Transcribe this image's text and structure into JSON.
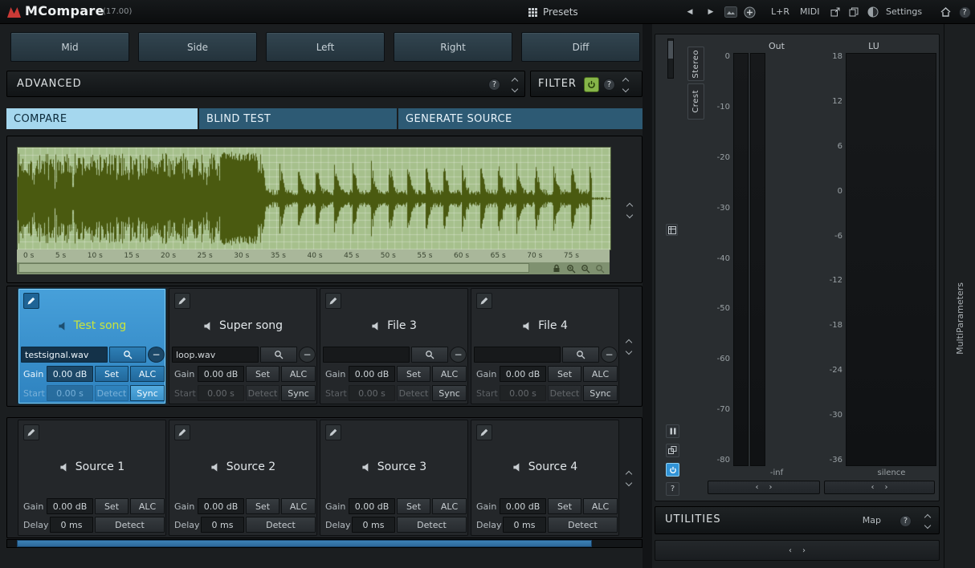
{
  "colors": {
    "accent_blue": "#3498d8",
    "active_tab": "#a5d7ee",
    "selected_slot": "#3795d3",
    "highlight_name": "#c9e43c",
    "filter_power_green": "#86b549",
    "wave_bg": "#a6c08c",
    "wave_grid": "rgba(255,255,255,0.28)",
    "wave_fg": "#4a5a10"
  },
  "titlebar": {
    "app_title": "MCompare",
    "version": "(17.00)",
    "presets_label": "Presets",
    "lr_label": "L+R",
    "midi_label": "MIDI",
    "settings_label": "Settings"
  },
  "channel_buttons": [
    "Mid",
    "Side",
    "Left",
    "Right",
    "Diff"
  ],
  "advanced_bar": {
    "label": "ADVANCED"
  },
  "filter_bar": {
    "label": "FILTER"
  },
  "tabs": {
    "compare": "COMPARE",
    "blind_test": "BLIND TEST",
    "generate_source": "GENERATE SOURCE"
  },
  "waveform": {
    "time_labels": [
      "0 s",
      "5 s",
      "10 s",
      "15 s",
      "20 s",
      "25 s",
      "30 s",
      "35 s",
      "40 s",
      "45 s",
      "50 s",
      "55 s",
      "60 s",
      "65 s",
      "70 s",
      "75 s"
    ]
  },
  "file_slots": [
    {
      "name": "Test song",
      "filename": "testsignal.wav",
      "gain_label": "Gain",
      "gain_value": "0.00 dB",
      "set_label": "Set",
      "alc_label": "ALC",
      "start_label": "Start",
      "start_value": "0.00 s",
      "detect_label": "Detect",
      "sync_label": "Sync"
    },
    {
      "name": "Super song",
      "filename": "loop.wav",
      "gain_label": "Gain",
      "gain_value": "0.00 dB",
      "set_label": "Set",
      "alc_label": "ALC",
      "start_label": "Start",
      "start_value": "0.00 s",
      "detect_label": "Detect",
      "sync_label": "Sync"
    },
    {
      "name": "File 3",
      "filename": "",
      "gain_label": "Gain",
      "gain_value": "0.00 dB",
      "set_label": "Set",
      "alc_label": "ALC",
      "start_label": "Start",
      "start_value": "0.00 s",
      "detect_label": "Detect",
      "sync_label": "Sync"
    },
    {
      "name": "File 4",
      "filename": "",
      "gain_label": "Gain",
      "gain_value": "0.00 dB",
      "set_label": "Set",
      "alc_label": "ALC",
      "start_label": "Start",
      "start_value": "0.00 s",
      "detect_label": "Detect",
      "sync_label": "Sync"
    }
  ],
  "source_slots": [
    {
      "name": "Source 1",
      "gain_label": "Gain",
      "gain_value": "0.00 dB",
      "set_label": "Set",
      "alc_label": "ALC",
      "delay_label": "Delay",
      "delay_value": "0 ms",
      "detect_label": "Detect"
    },
    {
      "name": "Source 2",
      "gain_label": "Gain",
      "gain_value": "0.00 dB",
      "set_label": "Set",
      "alc_label": "ALC",
      "delay_label": "Delay",
      "delay_value": "0 ms",
      "detect_label": "Detect"
    },
    {
      "name": "Source 3",
      "gain_label": "Gain",
      "gain_value": "0.00 dB",
      "set_label": "Set",
      "alc_label": "ALC",
      "delay_label": "Delay",
      "delay_value": "0 ms",
      "detect_label": "Detect"
    },
    {
      "name": "Source 4",
      "gain_label": "Gain",
      "gain_value": "0.00 dB",
      "set_label": "Set",
      "alc_label": "ALC",
      "delay_label": "Delay",
      "delay_value": "0 ms",
      "detect_label": "Detect"
    }
  ],
  "meter_panel": {
    "out_label": "Out",
    "lu_label": "LU",
    "stereo_tab": "Stereo",
    "crest_tab": "Crest",
    "out_scale": [
      "0",
      "-10",
      "-20",
      "-30",
      "-40",
      "-50",
      "-60",
      "-70",
      "-80"
    ],
    "out_value": "-inf",
    "lu_scale": [
      "18",
      "12",
      "6",
      "0",
      "-6",
      "-12",
      "-18",
      "-24",
      "-30",
      "-36"
    ],
    "lu_value": "silence"
  },
  "utilities_bar": {
    "label": "UTILITIES",
    "map_label": "Map"
  },
  "right_strip": {
    "label": "MultiParameters"
  }
}
